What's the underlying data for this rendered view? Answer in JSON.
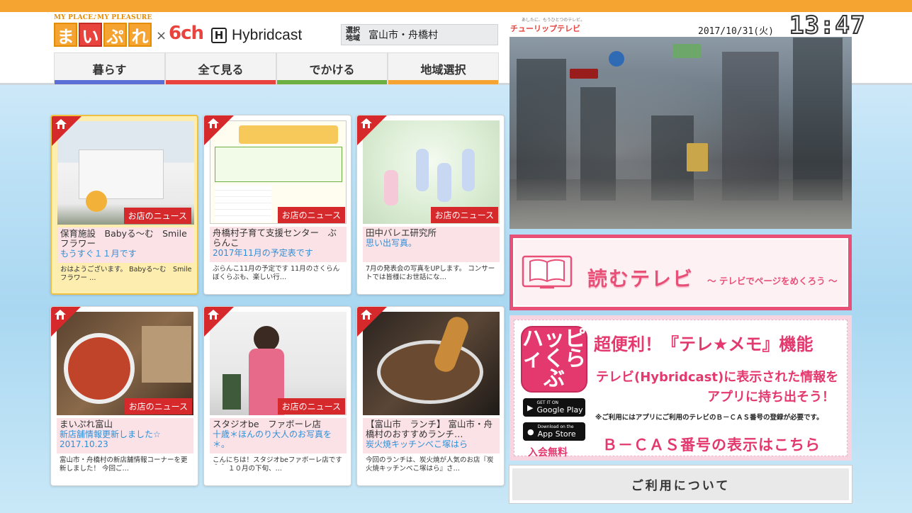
{
  "header": {
    "tagline": "MY PLACE♪MY PLEASURE",
    "logo_chars": [
      "ま",
      "い",
      "ぷ",
      "れ"
    ],
    "cross": "×",
    "channel": "6ch",
    "hybrid_mark": "H",
    "hybrid_text": "Hybridcast",
    "region_label": "選択 地域",
    "region_value": "富山市・舟橋村"
  },
  "tabs": [
    {
      "label": "暮らす",
      "color": "#5b6fd6"
    },
    {
      "label": "全て見る",
      "color": "#e8433c"
    },
    {
      "label": "でかける",
      "color": "#6cb043"
    },
    {
      "label": "地域選択",
      "color": "#f6a431"
    }
  ],
  "broadcaster": {
    "tagline": "あしたに、もうひとつのテレビ。",
    "name": "チューリップテレビ"
  },
  "date": "2017/10/31(火)",
  "clock": "13:47",
  "news_badge": "お店のニュース",
  "cards": [
    {
      "title": "保育施設　Babyる～む　Smileフラワー",
      "sub": "もうすぐ１１月です",
      "desc": "おはようございます。 Babyる～む　Smileフラワー …"
    },
    {
      "title": "舟橋村子育て支援センター　ぶらんこ",
      "sub": "2017年11月の予定表です",
      "desc": "ぶらんこ11月の予定です 11月のさくらんぼくらぶも、楽しい行…"
    },
    {
      "title": "田中バレエ研究所",
      "sub": "思い出写真。",
      "desc": "7月の発表会の写真をUPします。 コンサートでは皆様にお世話にな…"
    },
    {
      "title": "まいぷれ富山",
      "sub": "新店舗情報更新しました☆ 2017.10.23",
      "desc": "富山市・舟橋村の新店舗情報コーナーを更新しました！ 今回ご…"
    },
    {
      "title": "スタジオbe　ファボーレ店",
      "sub": "十歳＊ほんのり大人のお写真を＊。",
      "desc": "こんにちは！スタジオbeファボーレ店です＾＾ １０月の下旬、…"
    },
    {
      "title": "【富山市　ランチ】 富山市・舟橋村のおすすめランチ…",
      "sub": "炭火焼キッチンべこ塚はら",
      "desc": "今回のランチは、炭火焼が人気のお店『炭火焼キッチンべこ塚はら』さ…"
    }
  ],
  "yomu": {
    "title": "読むテレビ",
    "subtitle": "～ テレビでページをめくろう ～"
  },
  "happi": {
    "app_name": "ハッピィくらぶ",
    "title": "超便利！『テレ★メモ』機能",
    "line1": "テレビ(Hybridcast)に表示された情報を",
    "line2": "アプリに持ち出そう！",
    "note": "※ご利用にはアプリにご利用のテレビのＢ－ＣＡＳ番号の登録が必要です。",
    "bcas": "Ｂ－ＣＡＳ番号の表示はこちら",
    "google_small": "GET IT ON",
    "google": "Google Play",
    "apple_small": "Download on the",
    "apple": "App Store",
    "join": "入会無料"
  },
  "terms": "ご利用について"
}
